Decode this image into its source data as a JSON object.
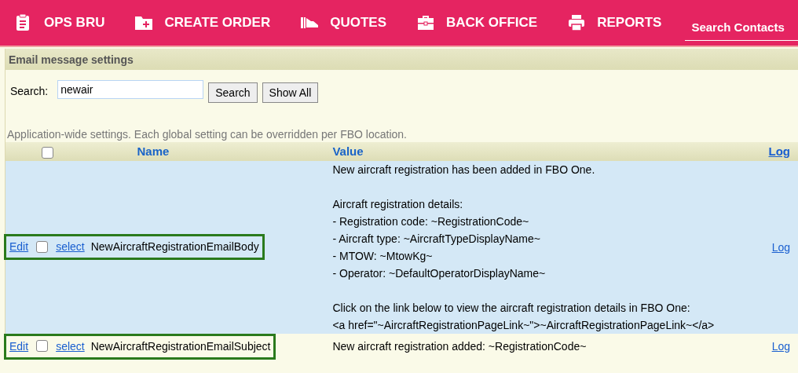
{
  "nav": {
    "items": [
      {
        "kind": "clipboard",
        "label": "OPS BRU"
      },
      {
        "kind": "folder",
        "label": "CREATE ORDER"
      },
      {
        "kind": "hand",
        "label": "QUOTES"
      },
      {
        "kind": "briefcase",
        "label": "BACK OFFICE"
      },
      {
        "kind": "printer",
        "label": "REPORTS"
      }
    ],
    "search": {
      "placeholder": "Search Contacts"
    }
  },
  "panel": {
    "title": "Email message settings",
    "search": {
      "label": "Search:",
      "value": "newair",
      "buttons": [
        "Search",
        "Show All"
      ]
    },
    "caption": "Application-wide settings. Each global setting can be overridden per FBO location.",
    "table": {
      "select_all": {
        "checked": false
      },
      "columns": [
        "Name",
        "Value",
        "Log"
      ],
      "rows": [
        {
          "selected": true,
          "highlighted": true,
          "edit": "Edit",
          "checked": false,
          "select": "select",
          "name": "NewAircraftRegistrationEmailBody",
          "value": [
            [
              "New aircraft registration has been added in FBO One."
            ],
            [
              "Aircraft registration details:",
              "- Registration code: ~RegistrationCode~",
              "- Aircraft type: ~AircraftTypeDisplayName~",
              "- MTOW: ~MtowKg~",
              "- Operator: ~DefaultOperatorDisplayName~"
            ],
            [
              "Click on the link below to view the aircraft registration details in FBO One:",
              "<a href=\"~AircraftRegistrationPageLink~\">~AircraftRegistrationPageLink~</a>"
            ]
          ],
          "log": "Log"
        },
        {
          "selected": false,
          "highlighted": true,
          "edit": "Edit",
          "checked": false,
          "select": "select",
          "name": "NewAircraftRegistrationEmailSubject",
          "value": [
            [
              "New aircraft registration added: ~RegistrationCode~"
            ]
          ],
          "log": "Log"
        }
      ]
    }
  }
}
